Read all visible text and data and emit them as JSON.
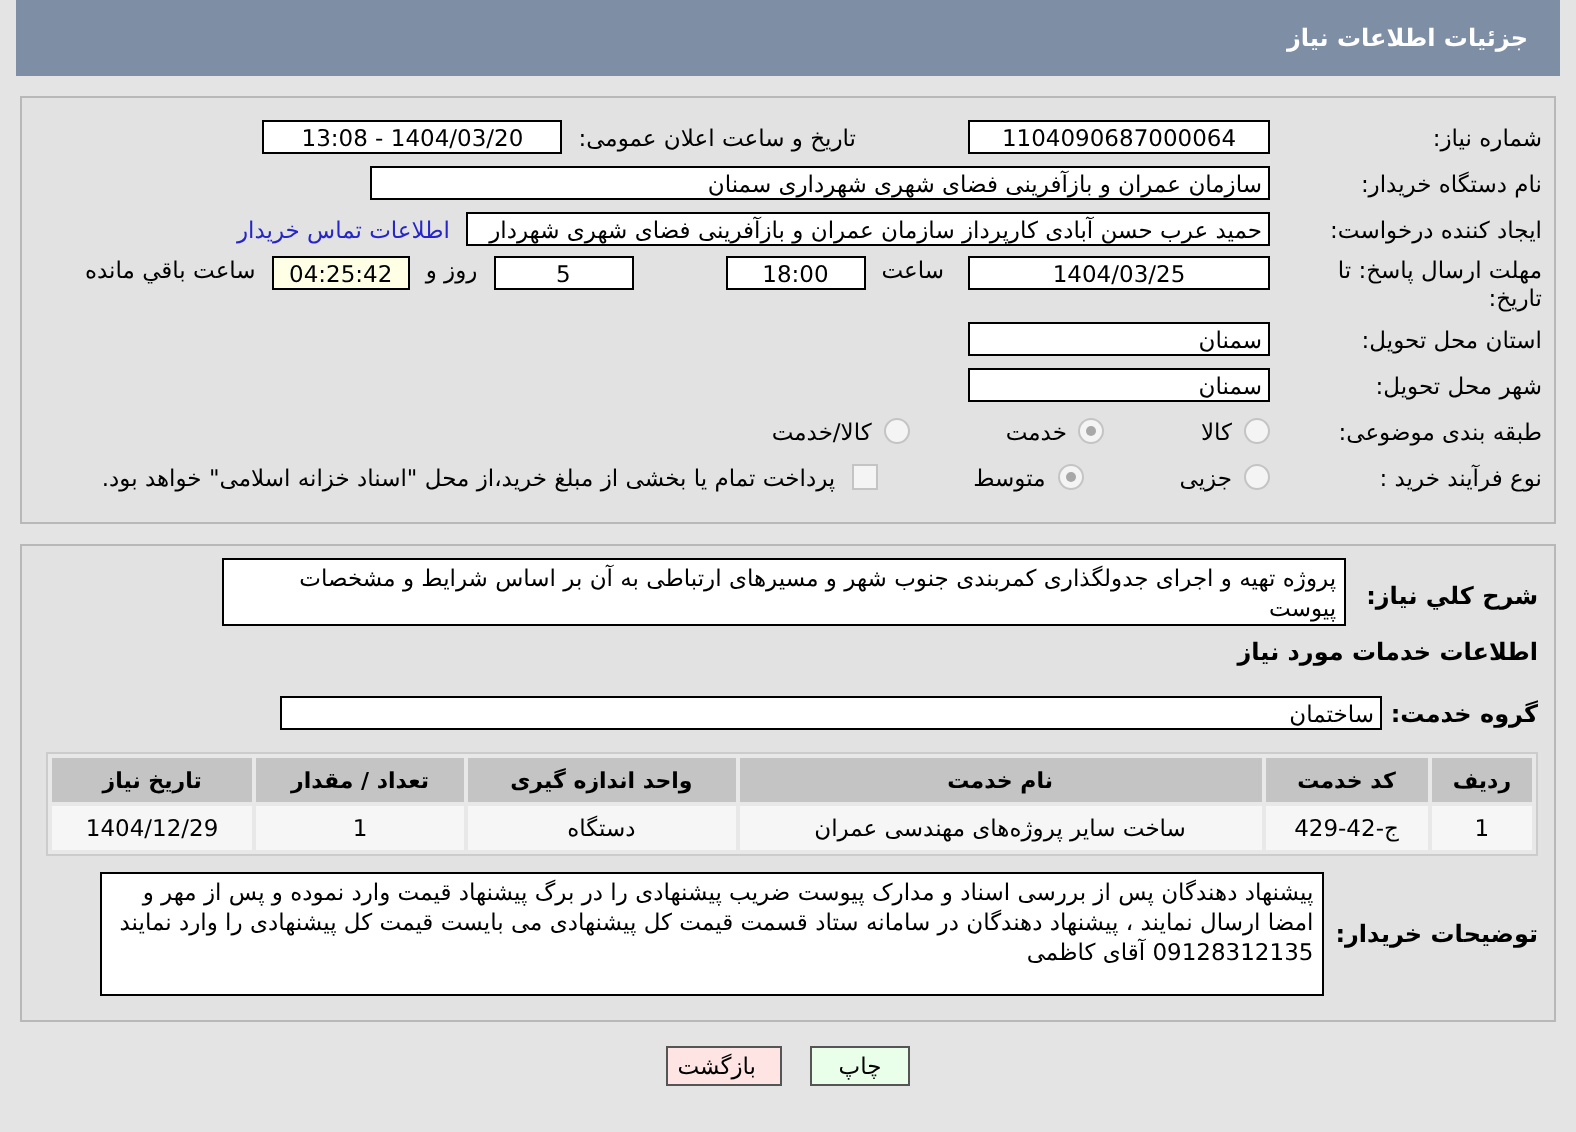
{
  "header": {
    "title": "جزئیات اطلاعات نیاز"
  },
  "need_number": {
    "label": "شماره نیاز:",
    "value": "1104090687000064"
  },
  "announce": {
    "label": "تاریخ و ساعت اعلان عمومی:",
    "value": "1404/03/20 - 13:08"
  },
  "buyer": {
    "label": "نام دستگاه خریدار:",
    "value": "سازمان عمران و بازآفرینی فضای شهری شهرداری سمنان"
  },
  "requester": {
    "label": "ایجاد کننده درخواست:",
    "value": "حمید عرب حسن آبادی کارپرداز سازمان عمران و بازآفرینی فضای شهری شهردار",
    "link": "اطلاعات تماس خریدار"
  },
  "deadline": {
    "label": "مهلت ارسال پاسخ: تا تاریخ:",
    "date": "1404/03/25",
    "time_label": "ساعت",
    "time": "18:00",
    "days": "5",
    "days_label": "روز و",
    "remaining": "04:25:42",
    "remaining_label": "ساعت باقي مانده"
  },
  "province": {
    "label": "استان محل تحویل:",
    "value": "سمنان"
  },
  "city": {
    "label": "شهر محل تحویل:",
    "value": "سمنان"
  },
  "category": {
    "label": "طبقه بندی موضوعی:",
    "options": [
      {
        "label": "کالا",
        "selected": false
      },
      {
        "label": "خدمت",
        "selected": true
      },
      {
        "label": "کالا/خدمت",
        "selected": false
      }
    ]
  },
  "process": {
    "label": "نوع فرآیند خرید :",
    "options": [
      {
        "label": "جزیی",
        "selected": false
      },
      {
        "label": "متوسط",
        "selected": true
      }
    ],
    "payment": {
      "checked": false,
      "text": "پرداخت تمام یا بخشی از مبلغ خرید،از محل \"اسناد خزانه اسلامی\" خواهد بود."
    }
  },
  "description": {
    "label": "شرح کلي نیاز:",
    "value": "پروژه تهیه و اجرای جدولگذاری کمربندی جنوب شهر و مسیرهای ارتباطی به آن بر اساس شرایط و مشخصات پیوست"
  },
  "services_title": "اطلاعات خدمات مورد نیاز",
  "service_group": {
    "label": "گروه خدمت:",
    "value": "ساختمان"
  },
  "table": {
    "columns": [
      "ردیف",
      "کد خدمت",
      "نام خدمت",
      "واحد اندازه گیری",
      "تعداد / مقدار",
      "تاریخ نیاز"
    ],
    "rows": [
      [
        "1",
        "ج-42-429",
        "ساخت سایر پروژه‌های مهندسی عمران",
        "دستگاه",
        "1",
        "1404/12/29"
      ]
    ]
  },
  "buyer_notes": {
    "label": "توضیحات خریدار:",
    "value": "پیشنهاد دهندگان پس از بررسی اسناد و مدارک پیوست ضریب پیشنهادی را در برگ پیشنهاد قیمت وارد نموده و پس از مهر و امضا ارسال نمایند ، پیشنهاد دهندگان در سامانه ستاد قسمت قیمت کل پیشنهادی می بایست قیمت کل پیشنهادی را وارد نمایند 09128312135 آقای کاظمی"
  },
  "buttons": [
    {
      "label": "چاپ",
      "kind": "print"
    },
    {
      "label": "بازگشت",
      "kind": "back"
    }
  ]
}
